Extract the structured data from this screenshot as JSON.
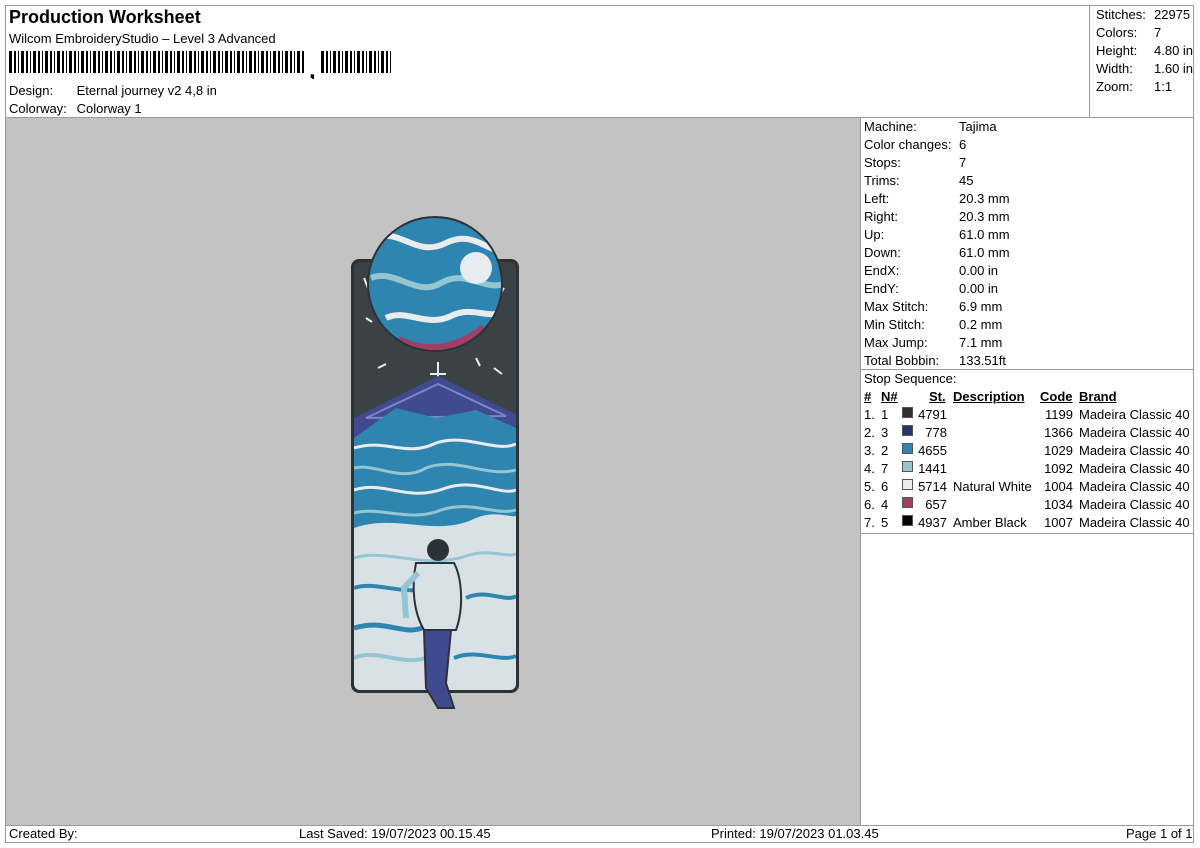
{
  "header": {
    "title": "Production Worksheet",
    "software": "Wilcom EmbroideryStudio – Level 3 Advanced",
    "barcode_char": ",",
    "design_label": "Design:",
    "design_value": "Eternal journey v2 4,8 in",
    "colorway_label": "Colorway:",
    "colorway_value": "Colorway 1"
  },
  "summary": {
    "stitches_label": "Stitches:",
    "stitches": "22975",
    "colors_label": "Colors:",
    "colors": "7",
    "height_label": "Height:",
    "height": "4.80 in",
    "width_label": "Width:",
    "width": "1.60 in",
    "zoom_label": "Zoom:",
    "zoom": "1:1"
  },
  "machine_info": [
    {
      "label": "Machine:",
      "value": "Tajima"
    },
    {
      "label": "Color changes:",
      "value": "6"
    },
    {
      "label": "Stops:",
      "value": "7"
    },
    {
      "label": "Trims:",
      "value": "45"
    },
    {
      "label": "Left:",
      "value": "20.3 mm"
    },
    {
      "label": "Right:",
      "value": "20.3 mm"
    },
    {
      "label": "Up:",
      "value": "61.0 mm"
    },
    {
      "label": "Down:",
      "value": "61.0 mm"
    },
    {
      "label": "EndX:",
      "value": "0.00 in"
    },
    {
      "label": "EndY:",
      "value": "0.00 in"
    },
    {
      "label": "Max Stitch:",
      "value": "6.9 mm"
    },
    {
      "label": "Min Stitch:",
      "value": "0.2 mm"
    },
    {
      "label": "Max Jump:",
      "value": "7.1 mm"
    },
    {
      "label": "Total Bobbin:",
      "value": "133.51ft"
    }
  ],
  "stop_sequence": {
    "title": "Stop Sequence:",
    "headers": {
      "num": "#",
      "n": "N#",
      "st": "St.",
      "desc": "Description",
      "code": "Code",
      "brand": "Brand"
    },
    "rows": [
      {
        "num": "1.",
        "n": "1",
        "color": "#2c3236",
        "st": "4791",
        "desc": "",
        "code": "1199",
        "brand": "Madeira Classic 40"
      },
      {
        "num": "2.",
        "n": "3",
        "color": "#2a3266",
        "st": "778",
        "desc": "",
        "code": "1366",
        "brand": "Madeira Classic 40"
      },
      {
        "num": "3.",
        "n": "2",
        "color": "#2e86b0",
        "st": "4655",
        "desc": "",
        "code": "1029",
        "brand": "Madeira Classic 40"
      },
      {
        "num": "4.",
        "n": "7",
        "color": "#93c6d2",
        "st": "1441",
        "desc": "",
        "code": "1092",
        "brand": "Madeira Classic 40"
      },
      {
        "num": "5.",
        "n": "6",
        "color": "#e8ecef",
        "st": "5714",
        "desc": "Natural White",
        "code": "1004",
        "brand": "Madeira Classic 40"
      },
      {
        "num": "6.",
        "n": "4",
        "color": "#a23d64",
        "st": "657",
        "desc": "",
        "code": "1034",
        "brand": "Madeira Classic 40"
      },
      {
        "num": "7.",
        "n": "5",
        "color": "#050505",
        "st": "4937",
        "desc": "Amber Black",
        "code": "1007",
        "brand": "Madeira Classic 40"
      }
    ]
  },
  "footer": {
    "created_by": "Created By:",
    "last_saved": "Last Saved: 19/07/2023 00.15.45",
    "printed": "Printed: 19/07/2023 01.03.45",
    "page": "Page 1 of 1"
  }
}
